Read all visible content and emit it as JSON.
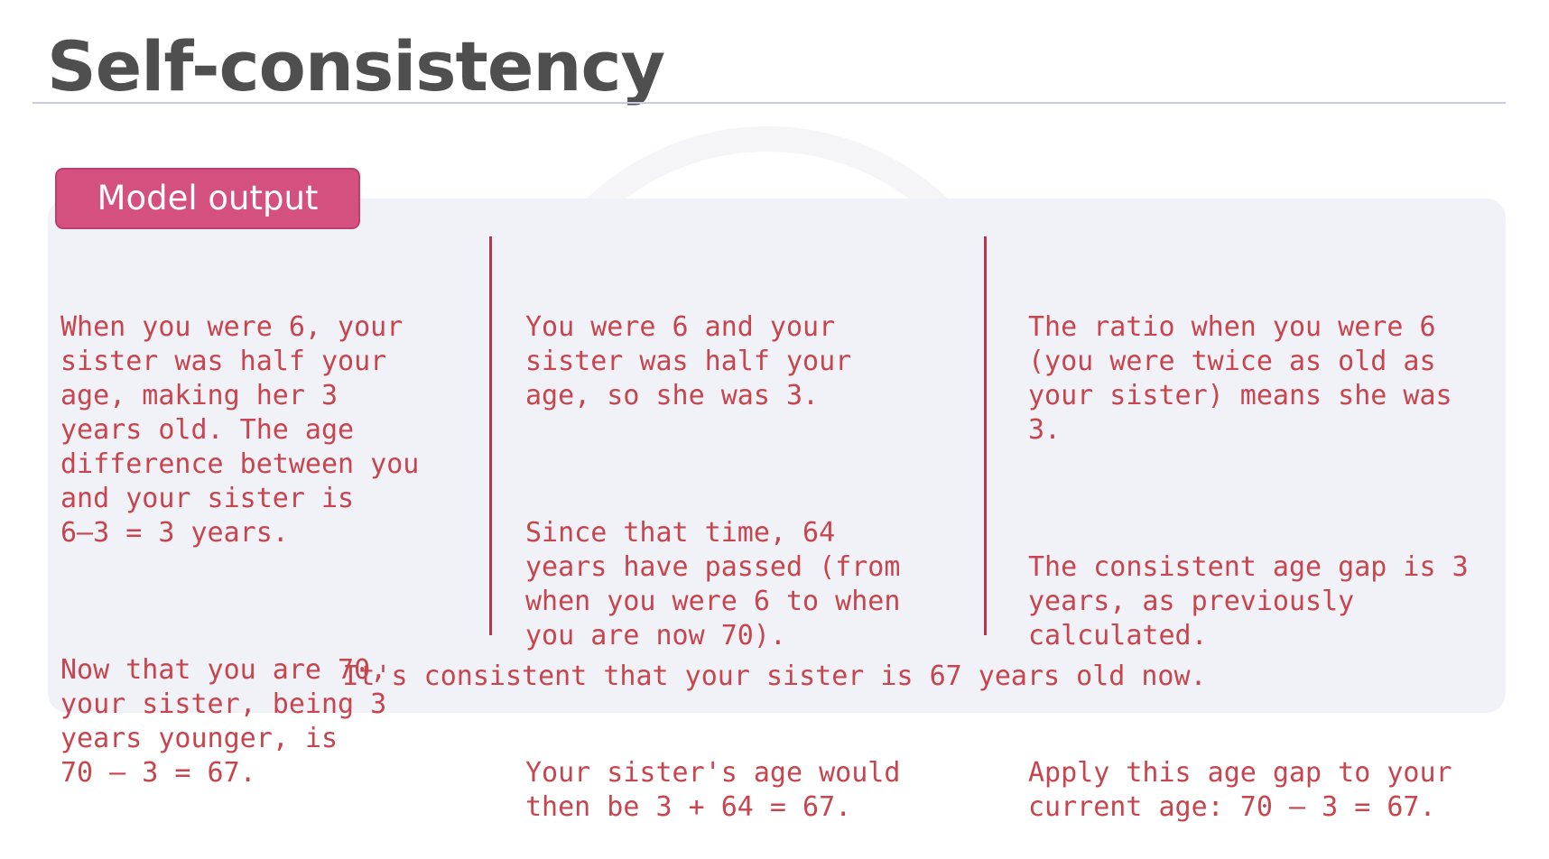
{
  "slide": {
    "title": "Self-consistency"
  },
  "badge": {
    "label": "Model output"
  },
  "columns": [
    {
      "paragraphs": [
        "When you were 6, your\nsister was half your\nage, making her 3\nyears old. The age\ndifference between you\nand your sister is\n6–3 = 3 years.",
        "Now that you are 70,\nyour sister, being 3\nyears younger, is\n70 – 3 = 67."
      ]
    },
    {
      "paragraphs": [
        "You were 6 and your\nsister was half your\nage, so she was 3.",
        "Since that time, 64\nyears have passed (from\nwhen you were 6 to when\nyou are now 70).",
        "Your sister's age would\nthen be 3 + 64 = 67."
      ]
    },
    {
      "paragraphs": [
        "The ratio when you were 6\n(you were twice as old as\nyour sister) means she was\n3.",
        "The consistent age gap is 3\nyears, as previously\ncalculated.",
        "Apply this age gap to your\ncurrent age: 70 – 3 = 67."
      ]
    }
  ],
  "conclusion": "It's consistent that your sister is 67 years old now.",
  "colors": {
    "title": "#4f4f4f",
    "badge": "#d4507e",
    "text": "#c6454e",
    "divider": "#b2384f",
    "panel": "#f0f1f6"
  }
}
